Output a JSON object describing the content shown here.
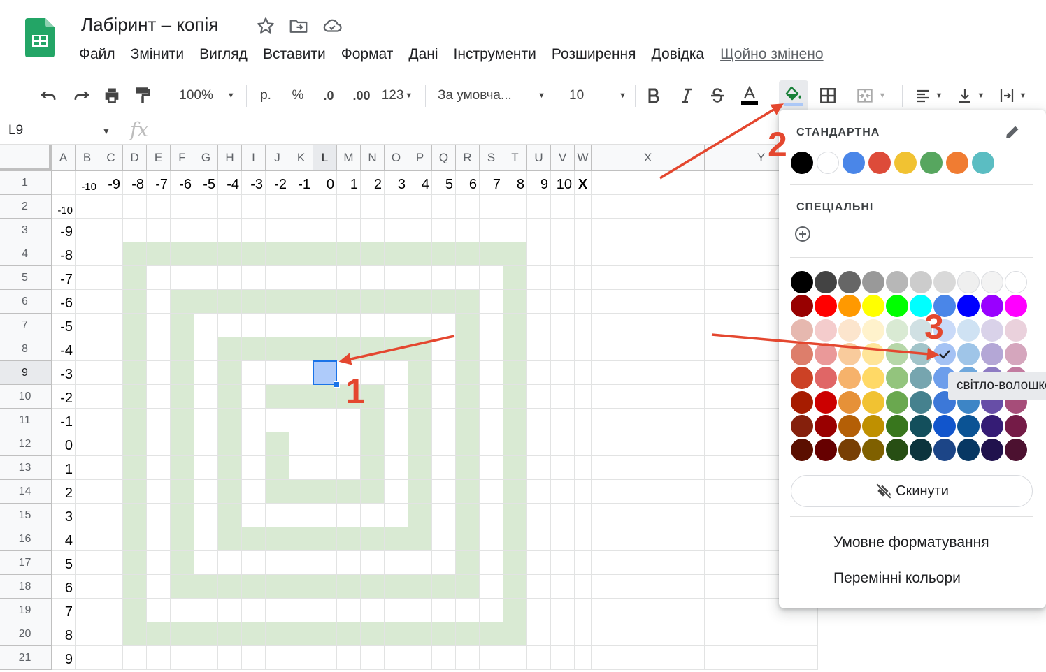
{
  "doc": {
    "title": "Лабіринт – копія",
    "icons": [
      "star-icon",
      "move-to-folder-icon",
      "cloud-saved-icon"
    ]
  },
  "menu": {
    "items": [
      "Файл",
      "Змінити",
      "Вигляд",
      "Вставити",
      "Формат",
      "Дані",
      "Інструменти",
      "Розширення",
      "Довідка"
    ],
    "last_edit": "Щойно змінено"
  },
  "toolbar": {
    "zoom": "100%",
    "currency": "р.",
    "percent": "%",
    "dec_decrease": ".0",
    "dec_increase": ".00",
    "number_format": "123",
    "font": "За умовча...",
    "font_size": "10",
    "text_color": "#000000",
    "active_tool": "fill-color"
  },
  "formula_bar": {
    "cell_ref": "L9",
    "fx": "fx",
    "value": ""
  },
  "grid": {
    "columns": [
      "A",
      "B",
      "C",
      "D",
      "E",
      "F",
      "G",
      "H",
      "I",
      "J",
      "K",
      "L",
      "M",
      "N",
      "O",
      "P",
      "Q",
      "R",
      "S",
      "T",
      "U",
      "V",
      "W",
      "X",
      "Y"
    ],
    "selected_column": "L",
    "selected_row": 9,
    "rows": [
      "1",
      "2",
      "3",
      "4",
      "5",
      "6",
      "7",
      "8",
      "9",
      "10",
      "11",
      "12",
      "13",
      "14",
      "15",
      "16",
      "17",
      "18",
      "19",
      "20",
      "21"
    ],
    "row1_labels": [
      "-10",
      "-9",
      "-8",
      "-7",
      "-6",
      "-5",
      "-4",
      "-3",
      "-2",
      "-1",
      "0",
      "1",
      "2",
      "3",
      "4",
      "5",
      "6",
      "7",
      "8",
      "9",
      "10",
      "X"
    ],
    "colA_labels": [
      "-10",
      "-9",
      "-8",
      "-7",
      "-6",
      "-5",
      "-4",
      "-3",
      "-2",
      "-1",
      "0",
      "1",
      "2",
      "3",
      "4",
      "5",
      "6",
      "7",
      "8",
      "9"
    ],
    "maze_color": "#d9ead3",
    "selected_cell_color": "#aecbfa"
  },
  "color_picker": {
    "standard_title": "СТАНДАРТНА",
    "standard": [
      "#000000",
      "#ffffff",
      "#4a86e8",
      "#dd4b39",
      "#f1c232",
      "#57a65f",
      "#f07c32",
      "#5bbdc2"
    ],
    "custom_title": "СПЕЦІАЛЬНІ",
    "palette": [
      [
        "#000000",
        "#434343",
        "#666666",
        "#999999",
        "#b7b7b7",
        "#cccccc",
        "#d9d9d9",
        "#efefef",
        "#f3f3f3",
        "#ffffff"
      ],
      [
        "#980000",
        "#ff0000",
        "#ff9900",
        "#ffff00",
        "#00ff00",
        "#00ffff",
        "#4a86e8",
        "#0000ff",
        "#9900ff",
        "#ff00ff"
      ],
      [
        "#e6b8af",
        "#f4cccc",
        "#fce5cd",
        "#fff2cc",
        "#d9ead3",
        "#d0e0e3",
        "#c9daf8",
        "#cfe2f3",
        "#d9d2e9",
        "#ead1dc"
      ],
      [
        "#dd7e6b",
        "#ea9999",
        "#f9cb9c",
        "#ffe599",
        "#b6d7a8",
        "#a2c4c9",
        "#a4c2f4",
        "#9fc5e8",
        "#b4a7d6",
        "#d5a6bd"
      ],
      [
        "#cc4125",
        "#e06666",
        "#f6b26b",
        "#ffd966",
        "#93c47d",
        "#76a5af",
        "#6d9eeb",
        "#6fa8dc",
        "#8e7cc3",
        "#c27ba0"
      ],
      [
        "#a61c00",
        "#cc0000",
        "#e69138",
        "#f1c232",
        "#6aa84f",
        "#45818e",
        "#3c78d8",
        "#3d85c6",
        "#674ea7",
        "#a64d79"
      ],
      [
        "#85200c",
        "#990000",
        "#b45f06",
        "#bf9000",
        "#38761d",
        "#134f5c",
        "#1155cc",
        "#0b5394",
        "#351c75",
        "#741b47"
      ],
      [
        "#5b0f00",
        "#660000",
        "#783f04",
        "#7f6000",
        "#274e13",
        "#0c343d",
        "#1c4587",
        "#073763",
        "#20124d",
        "#4c1130"
      ]
    ],
    "selected_swatch": {
      "row": 3,
      "col": 6
    },
    "tooltip": "світло-волошковий",
    "reset_label": "Скинути",
    "conditional_formatting": "Умовне форматування",
    "alternating_colors": "Перемінні кольори"
  },
  "annotations": {
    "labels": [
      "1",
      "2",
      "3"
    ],
    "color": "#e4472f"
  }
}
